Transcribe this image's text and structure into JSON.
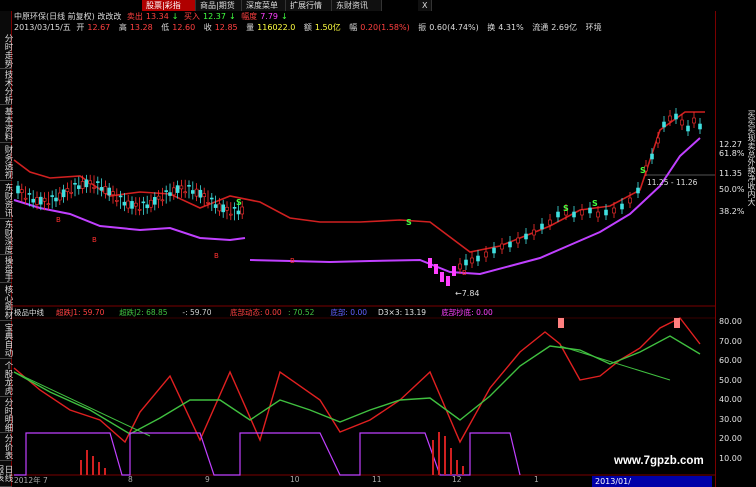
{
  "toolbar": {
    "buttons": [
      "股票|彩指",
      "商品|期货",
      "深度菜单",
      "扩展行情",
      "东财资讯"
    ],
    "close": "X",
    "active_index": 0
  },
  "sidebar": {
    "tabs": [
      "分时走势",
      "技术分析",
      "基本资料",
      "财务透视",
      "东财资讯",
      "东财深度",
      "操盘手",
      "核心题材",
      "宝典自动",
      "个股龙虎",
      "分时明细",
      "分价表",
      "日线报表"
    ]
  },
  "header": {
    "title": "中原环保(日线 前复权) 改改改",
    "sell_label": "卖出",
    "sell_value": "13.34",
    "buy_label": "买入",
    "buy_value": "12.37",
    "amp_label": "幅度",
    "amp_value": "7.79",
    "date": "2013/03/15/五",
    "open_label": "开",
    "open_value": "12.67",
    "high_label": "高",
    "high_value": "13.28",
    "low_label": "低",
    "low_value": "12.60",
    "close_label": "收",
    "close_value": "12.85",
    "vol_label": "量",
    "vol_value": "116022.0",
    "amount_label": "额",
    "amount_value": "1.50亿",
    "change_label": "幅",
    "change_value": "0.20(1.58%)",
    "swing_label": "振",
    "swing_value": "0.60(4.74%)",
    "turnover_label": "换",
    "turnover_value": "4.31%",
    "float_label": "流通",
    "float_value": "2.69亿",
    "env_label": "环境"
  },
  "price_axis": {
    "labels": [
      "12.27",
      "61.8%",
      "11.35",
      "50.0%",
      "38.2%"
    ]
  },
  "right_panel_vertical": "买买买现卖总外换净收内大",
  "annotations": {
    "low_price": "7.84",
    "level_text": "11.25 - 11.26",
    "sell_marks": [
      "S",
      "S",
      "S",
      "S",
      "S"
    ],
    "buy_marks": [
      "B",
      "B",
      "B",
      "B",
      "B"
    ]
  },
  "indicator": {
    "name": "极品中线",
    "items": [
      {
        "label": "超跌J1",
        "value": "59.70",
        "color": "#ff4040"
      },
      {
        "label": "超跌J2",
        "value": "68.85",
        "color": "#40c040"
      },
      {
        "label": "-",
        "value": "59.70",
        "color": "#cccccc"
      },
      {
        "label": "底部动态",
        "value": "0.00",
        "color": "#ff4040"
      },
      {
        "label": "",
        "value": "70.52",
        "color": "#40c040"
      },
      {
        "label": "底部",
        "value": "0.00",
        "color": "#6060ff"
      },
      {
        "label": "D3×3",
        "value": "13.19",
        "color": "#e0e0e0"
      },
      {
        "label": "底部抄底",
        "value": "0.00",
        "color": "#ff40ff"
      }
    ],
    "axis_labels": [
      "80.00",
      "70.00",
      "60.00",
      "50.00",
      "40.00",
      "30.00",
      "20.00",
      "10.00"
    ]
  },
  "time_axis": {
    "labels": [
      "2012年 7",
      "8",
      "9",
      "10",
      "11",
      "12",
      "1"
    ],
    "current_date": "2013/01/"
  },
  "watermark": "www.7gpzb.com"
}
